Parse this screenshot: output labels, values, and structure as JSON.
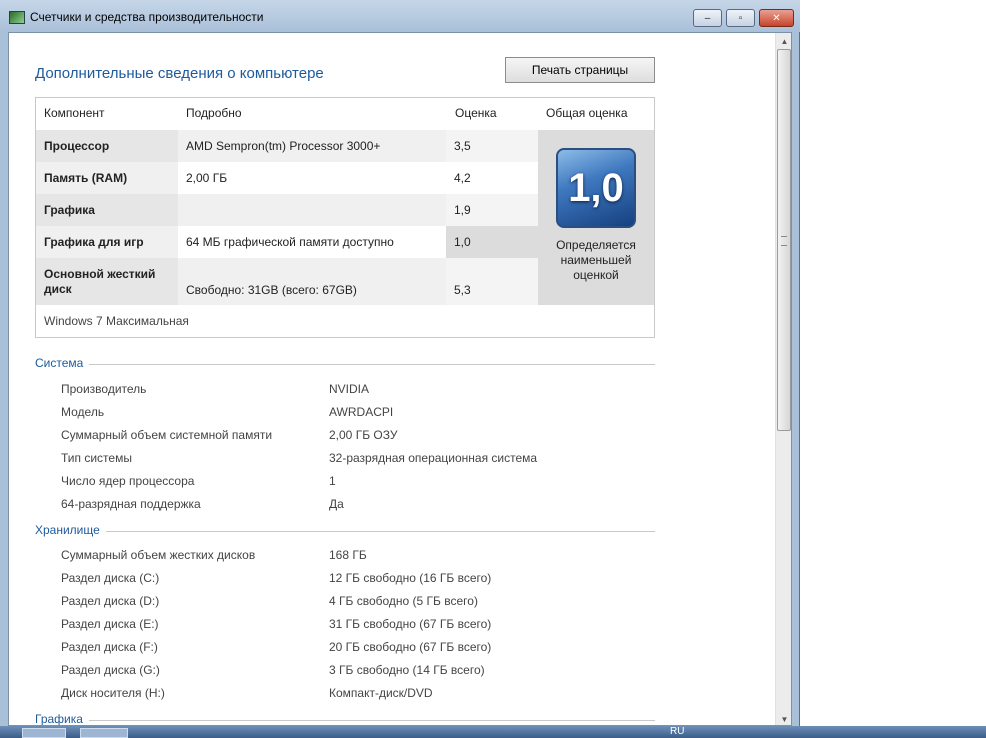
{
  "window": {
    "title": "Счетчики и средства производительности",
    "minimize_glyph": "–",
    "maximize_glyph": "▫",
    "close_glyph": "✕"
  },
  "page": {
    "title": "Дополнительные сведения о компьютере",
    "print_button": "Печать страницы"
  },
  "score_table": {
    "headers": {
      "component": "Компонент",
      "details": "Подробно",
      "rating": "Оценка",
      "overall": "Общая оценка"
    },
    "rows": [
      {
        "component": "Процессор",
        "details": "AMD Sempron(tm) Processor 3000+",
        "rating": "3,5"
      },
      {
        "component": "Память (RAM)",
        "details": "2,00 ГБ",
        "rating": "4,2"
      },
      {
        "component": "Графика",
        "details": "",
        "rating": "1,9"
      },
      {
        "component": "Графика для игр",
        "details": "64 МБ графической памяти доступно",
        "rating": "1,0"
      },
      {
        "component": "Основной жесткий диск",
        "details": "Свободно: 31GB (всего: 67GB)",
        "rating": "5,3"
      }
    ],
    "overall_score": "1,0",
    "overall_note": "Определяется наименьшей оценкой",
    "os_name": "Windows 7 Максимальная"
  },
  "system": {
    "title": "Система",
    "items": [
      {
        "label": "Производитель",
        "value": "NVIDIA"
      },
      {
        "label": "Модель",
        "value": "AWRDACPI"
      },
      {
        "label": "Суммарный объем системной памяти",
        "value": "2,00 ГБ ОЗУ"
      },
      {
        "label": "Тип системы",
        "value": "32-разрядная операционная система"
      },
      {
        "label": "Число ядер процессора",
        "value": "1"
      },
      {
        "label": "64-разрядная поддержка",
        "value": "Да"
      }
    ]
  },
  "storage": {
    "title": "Хранилище",
    "items": [
      {
        "label": "Суммарный объем жестких дисков",
        "value": "168 ГБ"
      },
      {
        "label": "Раздел диска (C:)",
        "value": "12 ГБ свободно (16 ГБ всего)"
      },
      {
        "label": "Раздел диска (D:)",
        "value": "4 ГБ свободно (5 ГБ всего)"
      },
      {
        "label": "Раздел диска (E:)",
        "value": "31 ГБ свободно (67 ГБ всего)"
      },
      {
        "label": "Раздел диска (F:)",
        "value": "20 ГБ свободно (67 ГБ всего)"
      },
      {
        "label": "Раздел диска (G:)",
        "value": "3 ГБ свободно (14 ГБ всего)"
      },
      {
        "label": "Диск носителя (H:)",
        "value": "Компакт-диск/DVD"
      }
    ]
  },
  "graphics": {
    "title": "Графика"
  },
  "taskbar": {
    "tray_lang": "RU"
  }
}
